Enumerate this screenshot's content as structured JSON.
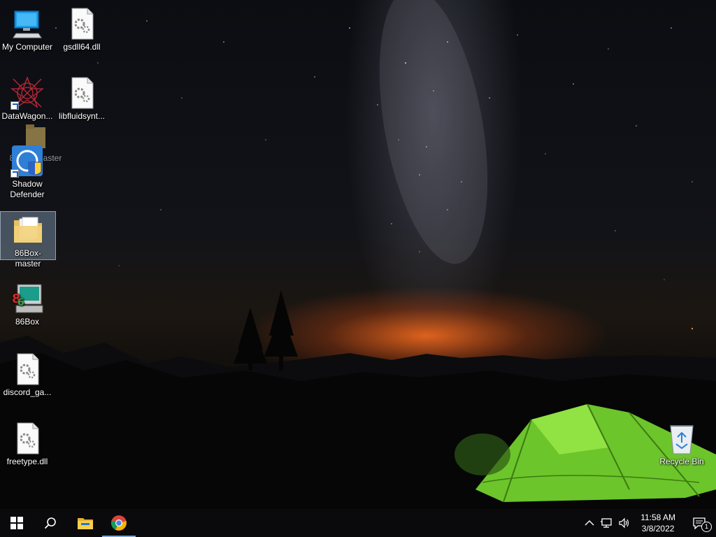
{
  "desktop": {
    "icons": [
      {
        "label": "My Computer",
        "icon": "computer-icon"
      },
      {
        "label": "gsdll64.dll",
        "icon": "dll-file-icon"
      },
      {
        "label": "DataWagon...",
        "icon": "datawagon-icon"
      },
      {
        "label": "libfluidsynt...",
        "icon": "dll-file-icon"
      },
      {
        "label": "Shadow Defender",
        "icon": "shadow-defender-icon"
      },
      {
        "label": "86Box-master",
        "icon": "folder-icon"
      },
      {
        "label": "86Box",
        "icon": "86box-app-icon"
      },
      {
        "label": "discord_ga...",
        "icon": "dll-file-icon"
      },
      {
        "label": "freetype.dll",
        "icon": "dll-file-icon"
      },
      {
        "label": "Recycle Bin",
        "icon": "recycle-bin-icon"
      }
    ],
    "drag_ghost_label": "86Box-master"
  },
  "taskbar": {
    "start_icon": "windows-start-icon",
    "search_icon": "search-icon",
    "pinned": [
      {
        "name": "File Explorer",
        "icon": "file-explorer-icon"
      },
      {
        "name": "Google Chrome",
        "icon": "chrome-icon"
      }
    ],
    "tray": {
      "chevron_icon": "chevron-up-icon",
      "network_icon": "network-icon",
      "volume_icon": "volume-icon",
      "time": "11:58 AM",
      "date": "3/8/2022",
      "notification_count": "1"
    }
  },
  "colors": {
    "taskbar": "#0a0a0c",
    "selection": "#aac8e6",
    "tent": "#7be02a",
    "active_indicator": "#7aa7d9"
  }
}
